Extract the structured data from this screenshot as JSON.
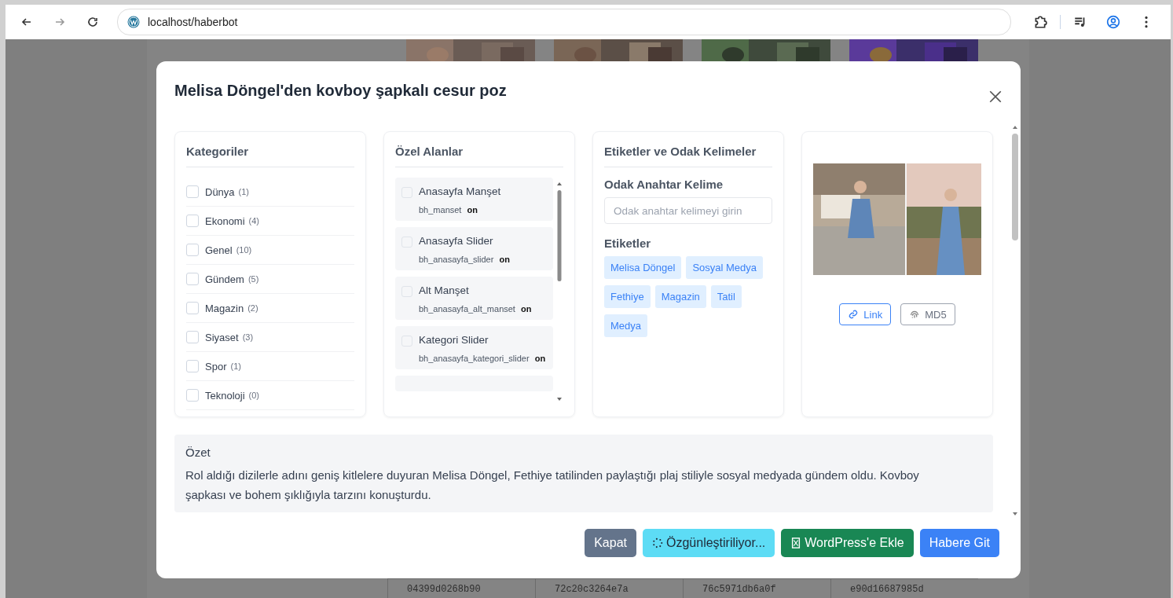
{
  "browser": {
    "url": "localhost/haberbot"
  },
  "background": {
    "hashes": [
      "04399d0268b90",
      "72c20c3264e7a",
      "76c5971db6a0f",
      "e90d16687985d"
    ]
  },
  "modal": {
    "title": "Melisa Döngel'den kovboy şapkalı cesur poz",
    "categories": {
      "title": "Kategoriler",
      "items": [
        {
          "name": "Dünya",
          "count": "(1)",
          "checked": false
        },
        {
          "name": "Ekonomi",
          "count": "(4)",
          "checked": false
        },
        {
          "name": "Genel",
          "count": "(10)",
          "checked": false
        },
        {
          "name": "Gündem",
          "count": "(5)",
          "checked": false
        },
        {
          "name": "Magazin",
          "count": "(2)",
          "checked": false
        },
        {
          "name": "Siyaset",
          "count": "(3)",
          "checked": false
        },
        {
          "name": "Spor",
          "count": "(1)",
          "checked": false
        },
        {
          "name": "Teknoloji",
          "count": "(0)",
          "checked": false
        }
      ]
    },
    "custom_fields": {
      "title": "Özel Alanlar",
      "items": [
        {
          "label": "Anasayfa Manşet",
          "key": "bh_manset",
          "value": "on",
          "checked": false
        },
        {
          "label": "Anasayfa Slider",
          "key": "bh_anasayfa_slider",
          "value": "on",
          "checked": false
        },
        {
          "label": "Alt Manşet",
          "key": "bh_anasayfa_alt_manset",
          "value": "on",
          "checked": false
        },
        {
          "label": "Kategori Slider",
          "key": "bh_anasayfa_kategori_slider",
          "value": "on",
          "checked": false
        }
      ]
    },
    "tags": {
      "title": "Etiketler ve Odak Kelimeler",
      "focus_label": "Odak Anahtar Kelime",
      "focus_placeholder": "Odak anahtar kelimeyi girin",
      "tags_label": "Etiketler",
      "tags": [
        "Melisa Döngel",
        "Sosyal Medya",
        "Fethiye",
        "Magazin",
        "Tatil",
        "Medya"
      ]
    },
    "media": {
      "buttons": [
        {
          "label": "Link",
          "kind": "link"
        },
        {
          "label": "MD5",
          "kind": "md5"
        }
      ]
    },
    "summary": {
      "label": "Özet",
      "text": "Rol aldığı dizilerle adını geniş kitlelere duyuran Melisa Döngel, Fethiye tatilinden paylaştığı plaj stiliyle sosyal medyada gündem oldu. Kovboy şapkası ve bohem şıklığıyla tarzını konuşturdu."
    },
    "buttons": [
      {
        "label": "Kapat",
        "kind": "secondary"
      },
      {
        "label": "Özgünleştiriliyor...",
        "kind": "loading"
      },
      {
        "label": "WordPress'e Ekle",
        "kind": "wordpress"
      },
      {
        "label": "Habere Git",
        "kind": "primary"
      }
    ]
  }
}
